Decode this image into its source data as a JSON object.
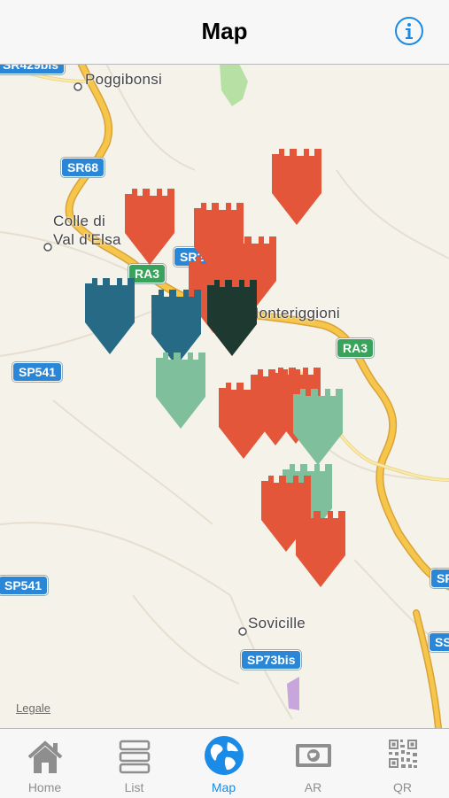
{
  "header": {
    "title": "Map"
  },
  "map": {
    "places": [
      "Poggibonsi",
      "Colle di",
      "Val d'Elsa",
      "Monteriggioni",
      "Sovicille"
    ],
    "roads": [
      "SR429bis",
      "SR68",
      "SR2",
      "RA3",
      "RA3",
      "SP541",
      "SP541",
      "SP73bis",
      "SP",
      "SS"
    ],
    "legal": "Legale",
    "marker_colors": {
      "red": "#e4563a",
      "blue": "#266a86",
      "mint": "#7fbf9c",
      "dark": "#1e3a30"
    }
  },
  "tabs": [
    {
      "label": "Home",
      "icon": "home-icon"
    },
    {
      "label": "List",
      "icon": "list-icon"
    },
    {
      "label": "Map",
      "icon": "globe-icon",
      "active": true
    },
    {
      "label": "AR",
      "icon": "ar-icon"
    },
    {
      "label": "QR",
      "icon": "qr-icon"
    }
  ]
}
